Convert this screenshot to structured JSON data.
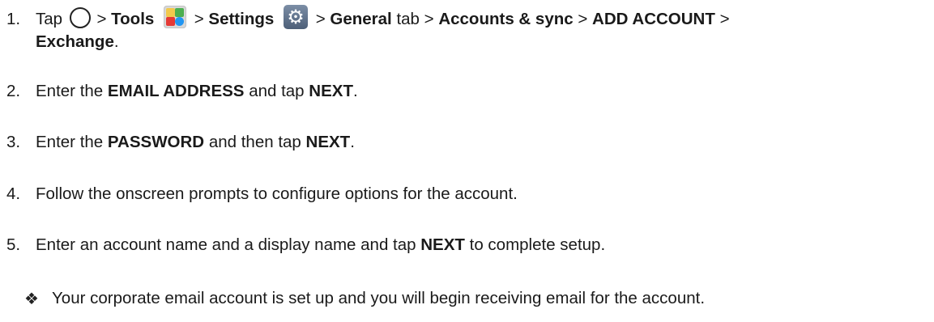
{
  "steps": [
    {
      "number": "1.",
      "tap": "Tap",
      "sep1": ">",
      "tools": "Tools",
      "sep2": ">",
      "settings": "Settings",
      "sep3": ">",
      "general": "General",
      "tab": "tab",
      "sep4": ">",
      "accounts_sync": "Accounts & sync",
      "sep5": ">",
      "add_account": "ADD ACCOUNT",
      "sep6": ">",
      "exchange": "Exchange",
      "period": "."
    },
    {
      "number": "2.",
      "pre": "Enter the",
      "email": "EMAIL ADDRESS",
      "mid": "and tap",
      "next": "NEXT",
      "end": "."
    },
    {
      "number": "3.",
      "pre": "Enter the",
      "password": "PASSWORD",
      "mid": "and then tap",
      "next": "NEXT",
      "end": "."
    },
    {
      "number": "4.",
      "text": "Follow the onscreen prompts to configure options for the account."
    },
    {
      "number": "5.",
      "pre": "Enter an account name and a display name and tap",
      "next": "NEXT",
      "end": "to complete setup."
    }
  ],
  "result": {
    "bullet": "❖",
    "text": "Your corporate email account is set up and you will begin receiving email for the account."
  },
  "icons": {
    "home": "home-circle-icon",
    "tools": "tools-folder-icon",
    "settings": "settings-gear-icon"
  }
}
